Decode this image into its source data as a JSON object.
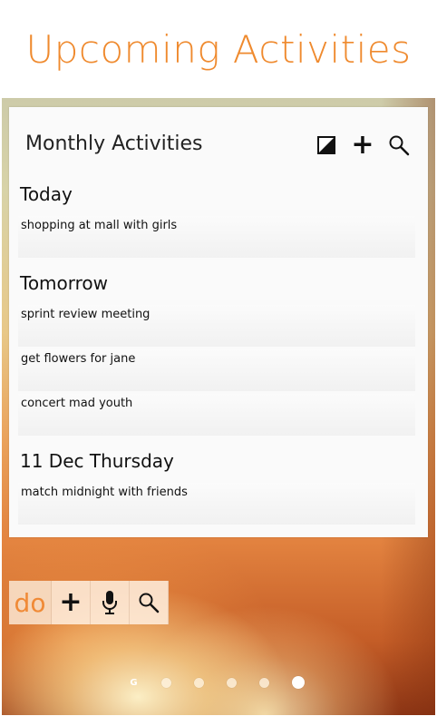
{
  "page_title": "Upcoming Activities",
  "widget": {
    "title": "Monthly Activities",
    "header_icons": [
      "contrast-icon",
      "plus-icon",
      "search-icon"
    ],
    "sections": [
      {
        "label": "Today",
        "items": [
          "shopping at mall with girls"
        ]
      },
      {
        "label": "Tomorrow",
        "items": [
          "sprint review meeting",
          "get flowers for jane",
          "concert mad youth"
        ]
      },
      {
        "label": "11 Dec Thursday",
        "items": [
          "match midnight with friends"
        ]
      }
    ]
  },
  "toolbar": {
    "app_label": "do",
    "icons": [
      "plus-icon",
      "microphone-icon",
      "search-icon"
    ]
  },
  "page_indicator": {
    "google_glyph": "G",
    "count": 6,
    "active_index": 5
  },
  "colors": {
    "accent": "#ef8a2e"
  }
}
